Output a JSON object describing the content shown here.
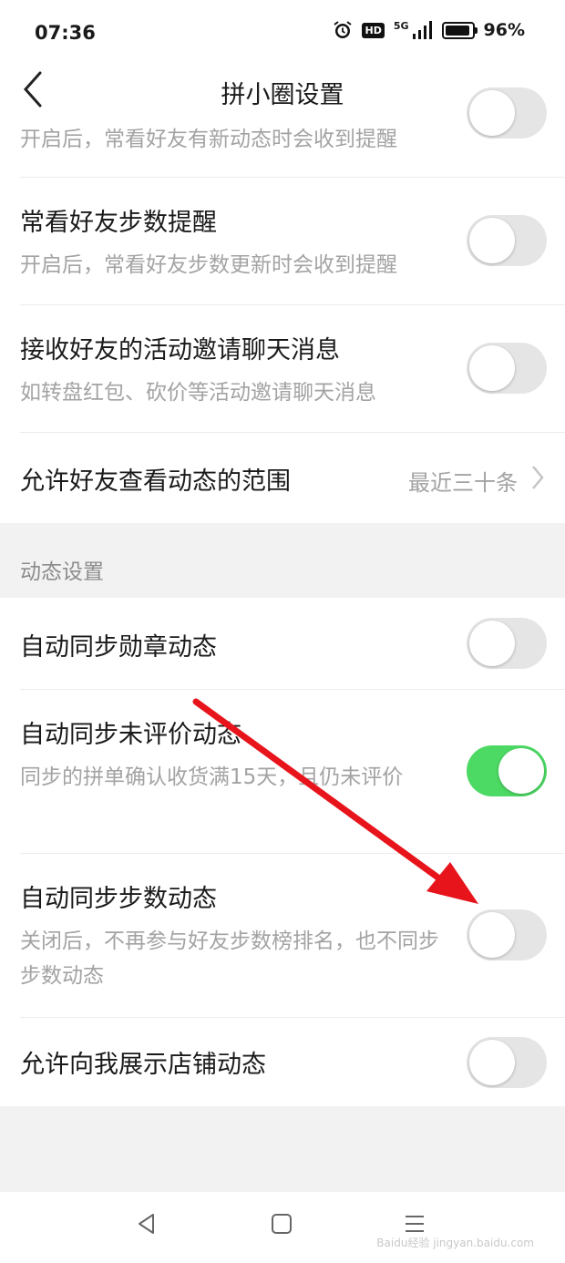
{
  "status_bar": {
    "time": "07:36",
    "hd": "HD",
    "network": "5G",
    "battery": "96%",
    "battery_level": 0.96
  },
  "header": {
    "title": "拼小圈设置",
    "back_icon": "chevron-left-icon"
  },
  "group1": {
    "partial_sub": "开启后，常看好友有新动态时会收到提醒",
    "rows": [
      {
        "title": "常看好友步数提醒",
        "subtitle": "开启后，常看好友步数更新时会收到提醒",
        "enabled": false
      },
      {
        "title": "接收好友的活动邀请聊天消息",
        "subtitle": "如转盘红包、砍价等活动邀请聊天消息",
        "enabled": false
      },
      {
        "title": "允许好友查看动态的范围",
        "value": "最近三十条"
      }
    ]
  },
  "section": {
    "title": "动态设置"
  },
  "group2": {
    "rows": [
      {
        "title": "自动同步勋章动态",
        "enabled": false
      },
      {
        "title": "自动同步未评价动态",
        "subtitle": "同步的拼单确认收货满15天，且仍未评价",
        "enabled": true
      },
      {
        "title": "自动同步步数动态",
        "subtitle": "关闭后，不再参与好友步数榜排名，也不同步步数动态",
        "enabled": false
      },
      {
        "title": "允许向我展示店铺动态",
        "enabled": false
      }
    ]
  },
  "colors": {
    "toggle_on": "#4cd964",
    "toggle_off": "#e5e5e5",
    "arrow": "#e8141b"
  },
  "watermark": "Baidu经验 jingyan.baidu.com",
  "bottom_nav": {
    "icons": [
      "back-triangle-icon",
      "home-square-icon",
      "menu-lines-icon"
    ]
  }
}
